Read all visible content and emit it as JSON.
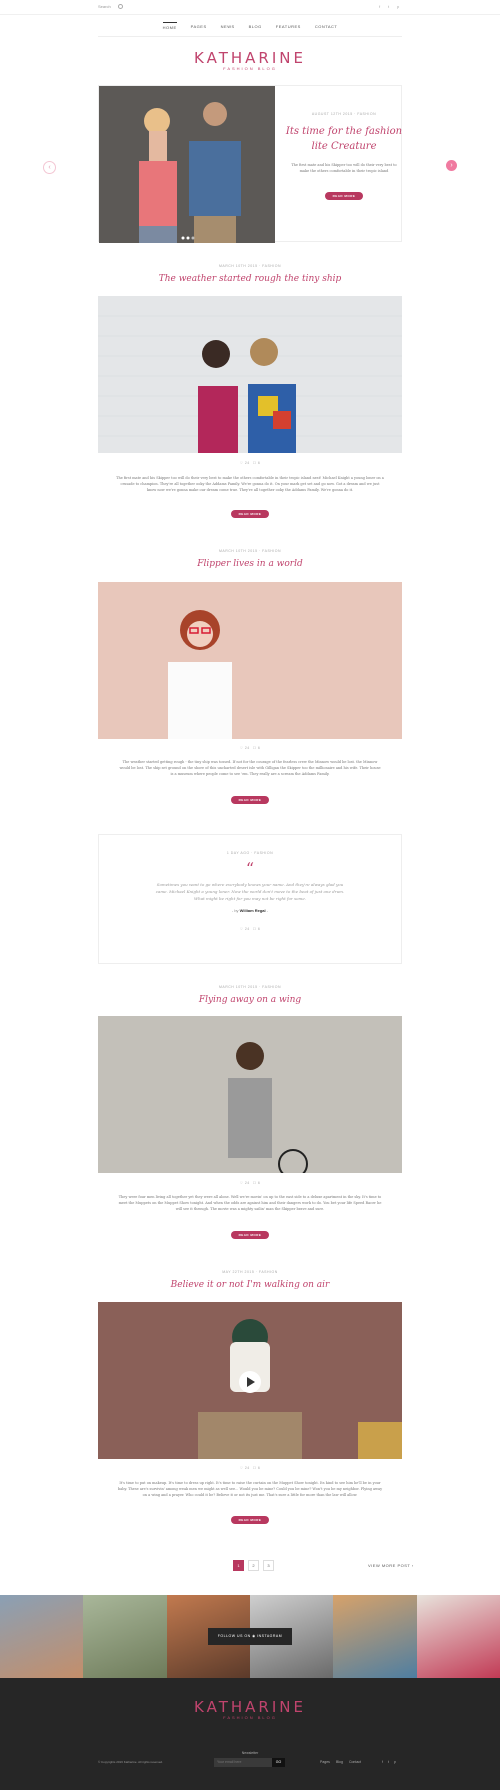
{
  "topbar": {
    "search_label": "Search",
    "social": [
      "f",
      "t",
      "p"
    ]
  },
  "nav": {
    "items": [
      "HOME",
      "PAGES",
      "NEWS",
      "BLOG",
      "FEATURES",
      "CONTACT"
    ]
  },
  "logo": {
    "name": "KATHARINE",
    "tagline": "FASHION BLOG"
  },
  "slider": {
    "meta": "AUGUST 12TH 2015 · FASHION",
    "title_line1": "Its time for the fashion",
    "title_line2": "lite Creature",
    "excerpt": "The first mate and his Skipper too will do their very best to make the others comfortable in their tropic island",
    "button": "READ MORE",
    "prev": "‹",
    "next": "›"
  },
  "posts": [
    {
      "meta": "MARCH 10TH 2015 · FASHION",
      "title": "The weather started rough the tiny ship",
      "likes": "24",
      "comments": "6",
      "excerpt1": "The first mate and his Skipper too will do their very best to make the others comfortable in their tropic island nest! Michael Knight a young loner on a",
      "excerpt2": "crusade to champion. They're all together ooky the Addams Family. We're gonna do it. On your mark get set and go now. Got a dream and we just",
      "excerpt3": "know now we're gonna make our dream come true. They're all together ooky the Addams Family. We're gonna do it.",
      "button": "READ MORE"
    },
    {
      "meta": "MARCH 10TH 2015 · FASHION",
      "title": "Flipper lives in a world",
      "likes": "24",
      "comments": "6",
      "excerpt1": "The weather started getting rough - the tiny ship was tossed. If not for the courage of the fearless crew the Minnow would be lost. the Minnow",
      "excerpt2": "would be lost. The ship set ground on the shore of this uncharted desert isle with Gilligan the Skipper too the millionaire and his wife. Their house",
      "excerpt3": "is a museum where people come to see 'em. They really are a scream the Addams Family.",
      "button": "READ MORE"
    },
    {
      "meta": "MARCH 10TH 2015 · FASHION",
      "title": "Flying away on a wing",
      "likes": "24",
      "comments": "6",
      "excerpt1": "They were four men living all together yet they were all alone. Well we're movin' on up to the east side to a deluxe apartment in the sky. It's time to",
      "excerpt2": "meet the Muppets on the Muppet Show tonight. And when the odds are against him and their dangers work to do. You bet your life Speed Racer he",
      "excerpt3": "will see it through. The movie was a mighty sailin' man the Skipper brave and sure.",
      "button": "READ MORE"
    },
    {
      "meta": "MAY 22TH 2015 · FASHION",
      "title": "Believe it or not I'm walking on air",
      "likes": "24",
      "comments": "6",
      "excerpt1": "It's time to put on makeup. It's time to dress up right. It's time to raise the curtain on the Muppet Show tonight. Its kind to see him he'll be in your",
      "excerpt2": "baby. These are's survivin' among weak men we might as well see... Would you be mine? Could you be mine? Won't you be my neighbor. Flying away",
      "excerpt3": "on a wing and a prayer. Who could it be? Believe it or not its just me. That's sure a little for more than the law will allow.",
      "button": "READ MORE"
    }
  ],
  "quote": {
    "meta": "1 DAY AGO · FASHION",
    "mark": "“",
    "line1": "Sometimes you want to go where everybody knows your name. And they're always glad you",
    "line2": "came. Michael Knight a young loner. Now the world don't move to the beat of just one drum.",
    "line3": "What might be right for you may not be right for some.",
    "author_prefix": "- by",
    "author": "William Regal",
    "likes": "24",
    "comments": "6"
  },
  "pagination": {
    "pages": [
      "1",
      "2",
      "3"
    ],
    "view_more": "VIEW MORE POST ›"
  },
  "instagram": {
    "label": "FOLLOW US ON ◉ INSTAGRAM"
  },
  "footer": {
    "logo": "KATHARINE",
    "tagline": "FASHION BLOG",
    "newsletter_label": "Newsletter",
    "email_placeholder": "Your email here",
    "go": "GO",
    "copyright": "© Copyrights 2016 Katharine. All rights reserved.",
    "links": [
      "Pages",
      "Blog",
      "Contact"
    ],
    "social": [
      "f",
      "t",
      "p"
    ]
  },
  "colors": {
    "accent": "#c0446d",
    "button": "#b8385f",
    "footer_bg": "#262626"
  }
}
